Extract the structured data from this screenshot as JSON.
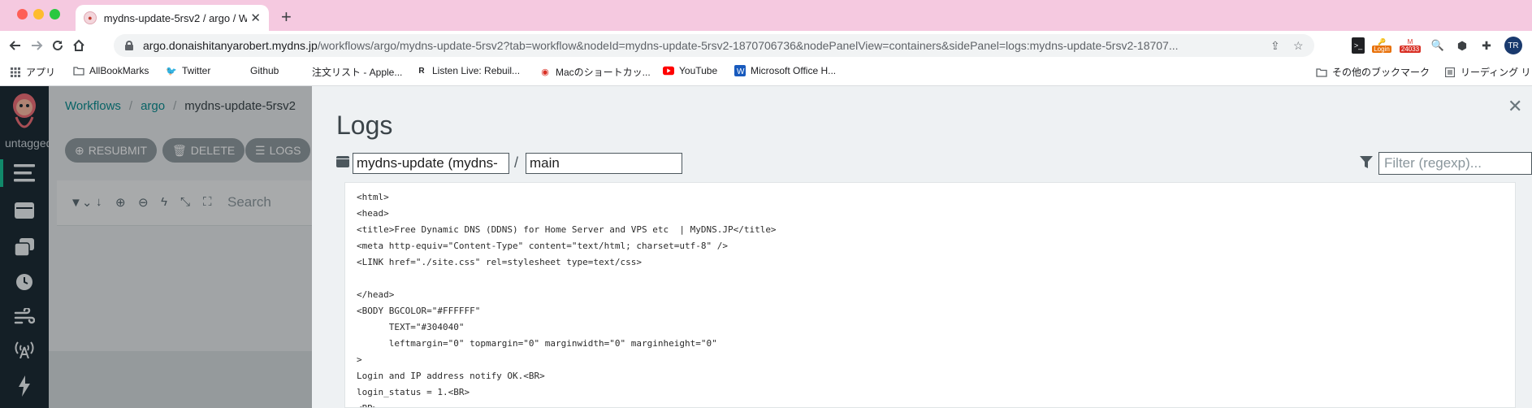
{
  "browser": {
    "tab_title": "mydns-update-5rsv2 / argo / W",
    "url_host": "argo.donaishitanyarobert.mydns.jp",
    "url_path": "/workflows/argo/mydns-update-5rsv2?tab=workflow&nodeId=mydns-update-5rsv2-1870706736&nodePanelView=containers&sidePanel=logs:mydns-update-5rsv2-18707...",
    "ext_login_label": "Login",
    "ext_gmail_count": "24033",
    "profile_initials": "TR"
  },
  "bookmarks": [
    {
      "label": "アプリ",
      "icon": "apps-grid-icon"
    },
    {
      "label": "AllBookMarks",
      "icon": "folder-icon"
    },
    {
      "label": "Twitter",
      "icon": "twitter-icon"
    },
    {
      "label": "Github",
      "icon": "github-icon"
    },
    {
      "label": "注文リスト - Apple...",
      "icon": "apple-icon"
    },
    {
      "label": "Listen Live: Rebuil...",
      "icon": "rebuild-icon"
    },
    {
      "label": "Macのショートカッ...",
      "icon": "shortcut-icon"
    },
    {
      "label": "YouTube",
      "icon": "youtube-icon"
    },
    {
      "label": "Microsoft Office H...",
      "icon": "word-icon"
    }
  ],
  "bookmarks_right": [
    {
      "label": "その他のブックマーク",
      "icon": "folder-icon"
    },
    {
      "label": "リーディング リ",
      "icon": "reading-list-icon"
    }
  ],
  "sidebar": {
    "namespace": "untagged"
  },
  "breadcrumb": {
    "workflows": "Workflows",
    "namespace": "argo",
    "current": "mydns-update-5rsv2"
  },
  "actions": {
    "resubmit": "RESUBMIT",
    "delete": "DELETE",
    "logs": "LOGS"
  },
  "graph_toolbar": {
    "search_label": "Search"
  },
  "logs_panel": {
    "title": "Logs",
    "pod_value": "mydns-update (mydns-",
    "container_value": "main",
    "filter_placeholder": "Filter (regexp)..."
  },
  "log_lines": [
    "<html>",
    "<head>",
    "<title>Free Dynamic DNS (DDNS) for Home Server and VPS etc  | MyDNS.JP</title>",
    "<meta http-equiv=\"Content-Type\" content=\"text/html; charset=utf-8\" />",
    "<LINK href=\"./site.css\" rel=stylesheet type=text/css>",
    "",
    "</head>",
    "<BODY BGCOLOR=\"#FFFFFF\"",
    "      TEXT=\"#304040\"",
    "      leftmargin=\"0\" topmargin=\"0\" marginwidth=\"0\" marginheight=\"0\"",
    ">",
    "Login and IP address notify OK.<BR>",
    "login_status = 1.<BR>",
    "<BR>"
  ],
  "colors": {
    "accent": "#18be94",
    "rail": "#1c2b35",
    "link": "#0d8a8e",
    "tabstrip": "#f5c9e0"
  }
}
